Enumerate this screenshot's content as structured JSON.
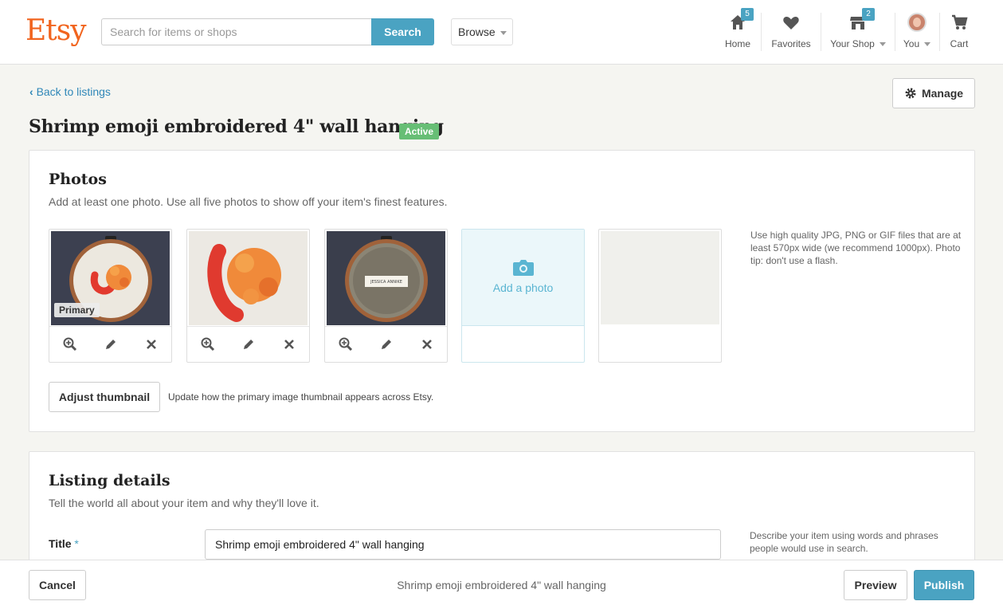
{
  "header": {
    "logo": "Etsy",
    "search_placeholder": "Search for items or shops",
    "search_button": "Search",
    "browse_label": "Browse",
    "nav": [
      {
        "label": "Home",
        "badge": "5",
        "icon": "home-icon"
      },
      {
        "label": "Favorites",
        "badge": "",
        "icon": "heart-icon"
      },
      {
        "label": "Your Shop",
        "badge": "2",
        "icon": "shop-icon"
      },
      {
        "label": "You",
        "badge": "",
        "icon": "avatar"
      },
      {
        "label": "Cart",
        "badge": "",
        "icon": "cart-icon"
      }
    ]
  },
  "page": {
    "back_link": "Back to listings",
    "manage_button": "Manage",
    "title": "Shrimp emoji embroidered 4\" wall hanging",
    "status": "Active"
  },
  "photos": {
    "heading": "Photos",
    "subtitle": "Add at least one photo. Use all five photos to show off your item's finest features.",
    "primary_tag": "Primary",
    "add_photo_label": "Add a photo",
    "tip": "Use high quality JPG, PNG or GIF files that are at least 570px wide (we recommend 1000px). Photo tip: don't use a flash.",
    "adjust_button": "Adjust thumbnail",
    "adjust_note": "Update how the primary image thumbnail appears across Etsy.",
    "label_text": "JESSICA ANNIKE"
  },
  "details": {
    "heading": "Listing details",
    "subtitle": "Tell the world all about your item and why they'll love it.",
    "title_label": "Title",
    "title_required": "*",
    "title_value": "Shrimp emoji embroidered 4\" wall hanging",
    "title_hint": "Describe your item using words and phrases people would use in search."
  },
  "footer": {
    "cancel_button": "Cancel",
    "listing_title": "Shrimp emoji embroidered 4\" wall hanging",
    "preview_button": "Preview",
    "publish_button": "Publish"
  },
  "colors": {
    "brand_orange": "#f1641e",
    "accent_blue": "#4aa3c2",
    "active_green": "#67be75",
    "background": "#f5f5f1"
  }
}
